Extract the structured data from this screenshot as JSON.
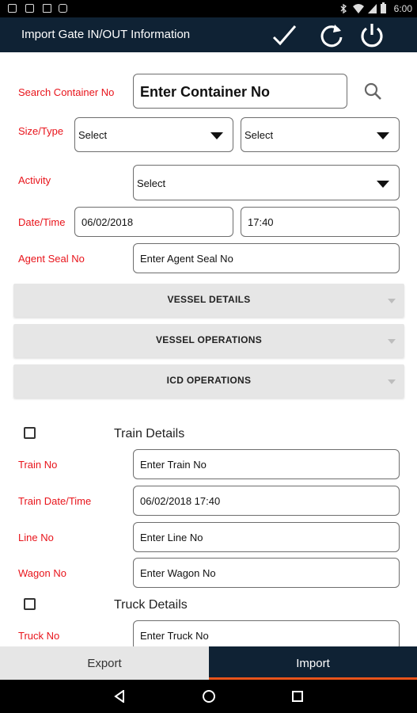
{
  "status_bar": {
    "time": "6:00"
  },
  "app_bar": {
    "title": "Import Gate IN/OUT Information",
    "actions": [
      "check-icon",
      "refresh-icon",
      "power-icon"
    ]
  },
  "search": {
    "label": "Search Container No",
    "placeholder": "Enter Container No"
  },
  "size_type": {
    "label": "Size/Type",
    "size_value": "Select",
    "type_value": "Select"
  },
  "activity": {
    "label": "Activity",
    "value": "Select"
  },
  "date_time": {
    "label": "Date/Time",
    "date": "06/02/2018",
    "time": "17:40"
  },
  "agent_seal": {
    "label": "Agent Seal No",
    "placeholder": "Enter Agent Seal No"
  },
  "sections": [
    "VESSEL DETAILS",
    "VESSEL OPERATIONS",
    "ICD OPERATIONS"
  ],
  "train": {
    "heading": "Train Details",
    "checked": false,
    "train_no_label": "Train No",
    "train_no_placeholder": "Enter Train No",
    "train_datetime_label": "Train Date/Time",
    "train_datetime_value": "06/02/2018 17:40",
    "line_no_label": "Line No",
    "line_no_placeholder": "Enter Line No",
    "wagon_no_label": "Wagon No",
    "wagon_no_placeholder": "Enter Wagon No"
  },
  "truck": {
    "heading": "Truck Details",
    "checked": false,
    "truck_no_label": "Truck No",
    "truck_no_placeholder": "Enter Truck No"
  },
  "bottom_tabs": [
    {
      "label": "Export",
      "active": false
    },
    {
      "label": "Import",
      "active": true
    }
  ],
  "colors": {
    "app_bar": "#0f2234",
    "label_red": "#e8141b",
    "tab_active_bg": "#0f2234",
    "tab_inactive_bg": "#e6e6e6",
    "tab_indicator": "#e8541b"
  }
}
